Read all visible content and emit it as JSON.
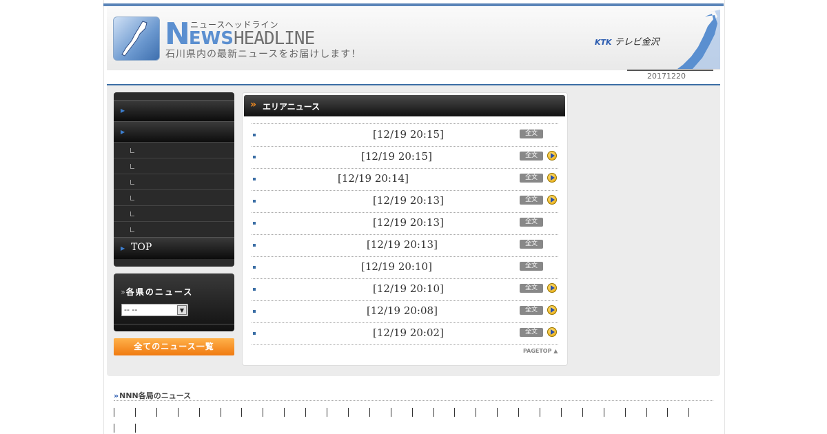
{
  "header": {
    "kana": "ニュースヘッドライン",
    "logo_n": "N",
    "logo_ews": "EWS",
    "logo_headline": "HEADLINE",
    "subtitle": "石川県内の最新ニュースをお届けします！",
    "brand_ktk": "KTK",
    "brand_tv": "テレビ金沢",
    "date": "20171220"
  },
  "sidenav": {
    "items": [
      {
        "label": ""
      },
      {
        "label": ""
      },
      {
        "label": "TOP"
      }
    ],
    "sub_items": [
      "",
      "",
      "",
      "",
      "",
      ""
    ]
  },
  "prefecture": {
    "title": "各県のニュース",
    "select_value": "--  --"
  },
  "all_news_button": "全てのニュース一覧",
  "area_news": {
    "title": "エリアニュース",
    "full_text_label": "全文",
    "pagetop": "PAGETOP ▲",
    "items": [
      {
        "time": "[12/19 20:15]",
        "video": false
      },
      {
        "time": "[12/19 20:15]",
        "video": true
      },
      {
        "time": "[12/19 20:14]",
        "video": true
      },
      {
        "time": "[12/19 20:13]",
        "video": true
      },
      {
        "time": "[12/19 20:13]",
        "video": false
      },
      {
        "time": "[12/19 20:13]",
        "video": false
      },
      {
        "time": "[12/19 20:10]",
        "video": false
      },
      {
        "time": "[12/19 20:10]",
        "video": true
      },
      {
        "time": "[12/19 20:08]",
        "video": true
      },
      {
        "time": "[12/19 20:02]",
        "video": true
      }
    ]
  },
  "nnn": {
    "title": "NNN各局のニュース"
  },
  "colors": {
    "accent_blue": "#3b6ea5",
    "orange": "#f07a10"
  }
}
